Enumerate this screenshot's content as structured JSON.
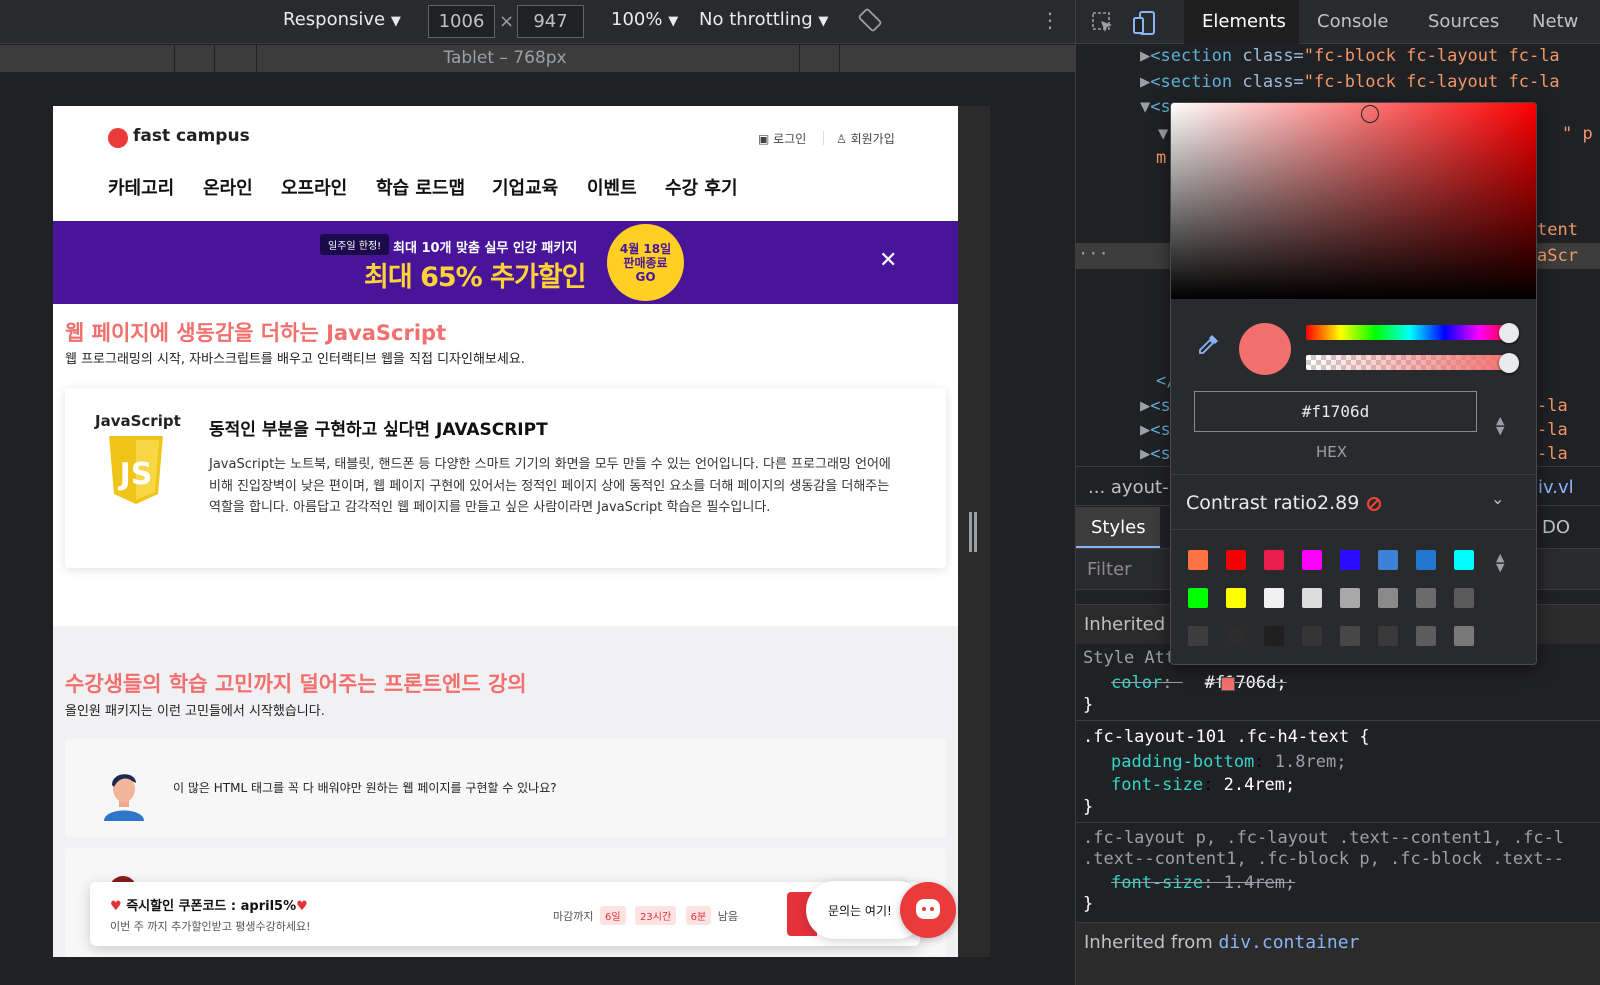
{
  "toolbar": {
    "device": "Responsive",
    "width": "1006",
    "times": "×",
    "height": "947",
    "zoom": "100%",
    "throttling": "No throttling",
    "media_query_label": "Tablet – 768px"
  },
  "page": {
    "logo": "fast campus",
    "login": "로그인",
    "signup": "회원가입",
    "nav": [
      "카테고리",
      "온라인",
      "오프라인",
      "학습 로드맵",
      "기업교육",
      "이벤트",
      "수강 후기"
    ],
    "banner": {
      "badge": "일주일 한정!",
      "subtitle": "최대 10개 맞춤 실무 인강 패키지",
      "headline": "최대 65% 추가할인",
      "circle_line1": "4월 18일",
      "circle_line2": "판매종료",
      "circle_line3": "GO",
      "close": "✕"
    },
    "section1": {
      "title": "웹 페이지에 생동감을 더하는 JavaScript",
      "subtitle": "웹 프로그래밍의 시작, 자바스크립트를 배우고 인터랙티브 웹을 직접 디자인해보세요.",
      "card_label": "JavaScript",
      "card_title": "동적인 부분을 구현하고 싶다면 JAVASCRIPT",
      "card_desc": "JavaScript는 노트북, 태블릿, 핸드폰 등 다양한 스마트 기기의 화면을 모두 만들 수 있는 언어입니다. 다른 프로그래밍 언어에 비해 진입장벽이 낮은 편이며, 웹 페이지 구현에 있어서는 정적인 페이지 상에 동적인 요소를 더해 페이지의 생동감을 더해주는 역할을 합니다. 아름답고 감각적인 웹 페이지를 만들고 싶은 사람이라면 JavaScript 학습은 필수입니다."
    },
    "section2": {
      "title": "수강생들의 학습 고민까지 덜어주는 프론트엔드 강의",
      "subtitle": "올인원 패키지는 이런 고민들에서 시작했습니다.",
      "worry1": "이 많은 HTML 태그를 꼭 다 배워야만 원하는 웹 페이지를 구현할 수 있나요?"
    },
    "coupon": {
      "title": "즉시할인 쿠폰코드 : april5%",
      "subtitle": "이번 주 까지 추가할인받고 평생수강하세요!",
      "deadline_prefix": "마감까지",
      "days": "6일",
      "hours": "23시간",
      "minutes": "6분",
      "deadline_suffix": "남음"
    },
    "chat_label": "문의는 여기!"
  },
  "devtools": {
    "tabs": [
      "Elements",
      "Console",
      "Sources",
      "Netw"
    ],
    "dom_lines": [
      {
        "prefix": "▶",
        "tag": "<section",
        "attr": " class=",
        "value": "\"fc-block fc-layout fc-la"
      },
      {
        "prefix": "▶",
        "tag": "<section",
        "attr": " class=",
        "value": "\"fc-block fc-layout fc-la"
      },
      {
        "prefix": "▼",
        "tag": "<s",
        "attr": "",
        "value": ""
      }
    ],
    "dom_fragments": [
      "\" p",
      "m'",
      "tent",
      "aScr",
      "</",
      "-la",
      "-la",
      "-la",
      "<s",
      "<s",
      "<s"
    ],
    "breadcrumb_prefix": "...",
    "breadcrumb": "ayout-",
    "breadcrumb_right": "iv.vl",
    "styles_tab": "Styles",
    "dom_tab": "DO",
    "filter_placeholder": "Filter",
    "inherited_from_partial": "Inherited f",
    "style_attr": "Style Attr",
    "css": {
      "color_prop": "color",
      "color_value": "#f1706d;",
      "rule1_selector": ".fc-layout-101 .fc-h4-text {",
      "rule1_props": [
        {
          "prop": "padding-bottom",
          "value": "1.8rem;"
        },
        {
          "prop": "font-size",
          "value": "2.4rem;"
        }
      ],
      "rule2_selector_a": ".fc-layout p, .fc-layout .text--content1, .fc-l",
      "rule2_selector_b": ".text--content1, .fc-block p, .fc-block .text--",
      "rule2_prop": "font-size",
      "rule2_value": "1.4rem;",
      "close_brace": "}"
    },
    "inherited_label": "Inherited from",
    "inherited_target": "div.container"
  },
  "color_picker": {
    "hex_value": "#f1706d",
    "format_label": "HEX",
    "contrast_label": "Contrast ratio",
    "contrast_value": "2.89",
    "current_color": "#f1706d",
    "alpha": 1.0,
    "palette": [
      "#ff7043",
      "#f00000",
      "#e91e4f",
      "#ff00ff",
      "#2a0dff",
      "#3b82d6",
      "#1f77d0",
      "#00ffff",
      "#00ff00",
      "#ffff00",
      "#f0f0f0",
      "#dcdcdc",
      "#a8a8a8",
      "#8a8a8a",
      "#6b6b6b",
      "#5a5a5a",
      "#3e3e3e",
      "#2c2c2c",
      "#202020",
      "#353535",
      "#474747",
      "#3a3a3a",
      "#5c5c5c",
      "#787878"
    ]
  },
  "colors": {
    "accent": "#f1706d",
    "banner": "#48159a",
    "devtools_bg": "#202124"
  }
}
